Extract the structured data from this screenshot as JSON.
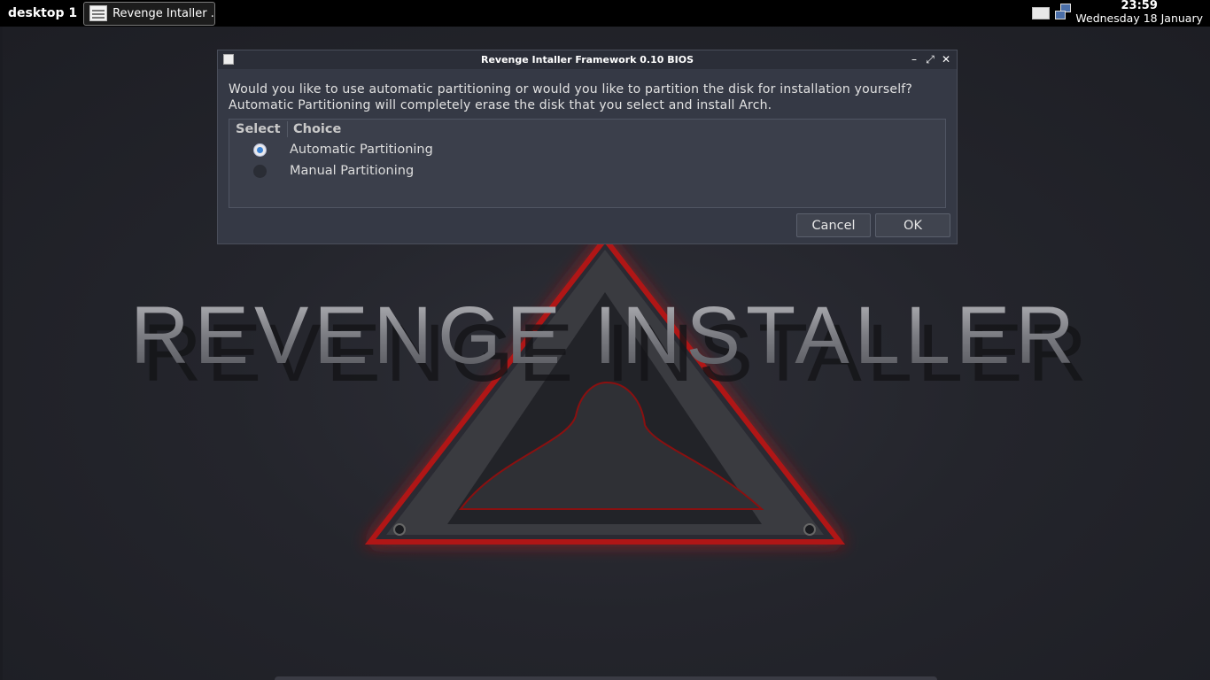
{
  "panel": {
    "desktop_label": "desktop 1",
    "task_button_label": "Revenge Intaller ...",
    "clock_time": "23:59",
    "clock_date": "Wednesday 18 January"
  },
  "wallpaper": {
    "logo_text": "REVENGE INSTALLER"
  },
  "dialog": {
    "title": "Revenge Intaller Framework 0.10 BIOS",
    "message_line1": "Would you like to use automatic partitioning or would you like to partition the disk for installation yourself?",
    "message_line2": "Automatic Partitioning will completely erase the disk that you select and install Arch.",
    "columns": {
      "select": "Select",
      "choice": "Choice"
    },
    "options": [
      {
        "label": "Automatic Partitioning",
        "selected": true
      },
      {
        "label": "Manual Partitioning",
        "selected": false
      }
    ],
    "cancel_label": "Cancel",
    "ok_label": "OK",
    "controls": {
      "minimize": "–",
      "maximize": "⤢",
      "close": "✕"
    }
  },
  "colors": {
    "accent": "#3c82d2",
    "logo_glow": "#c01818"
  }
}
